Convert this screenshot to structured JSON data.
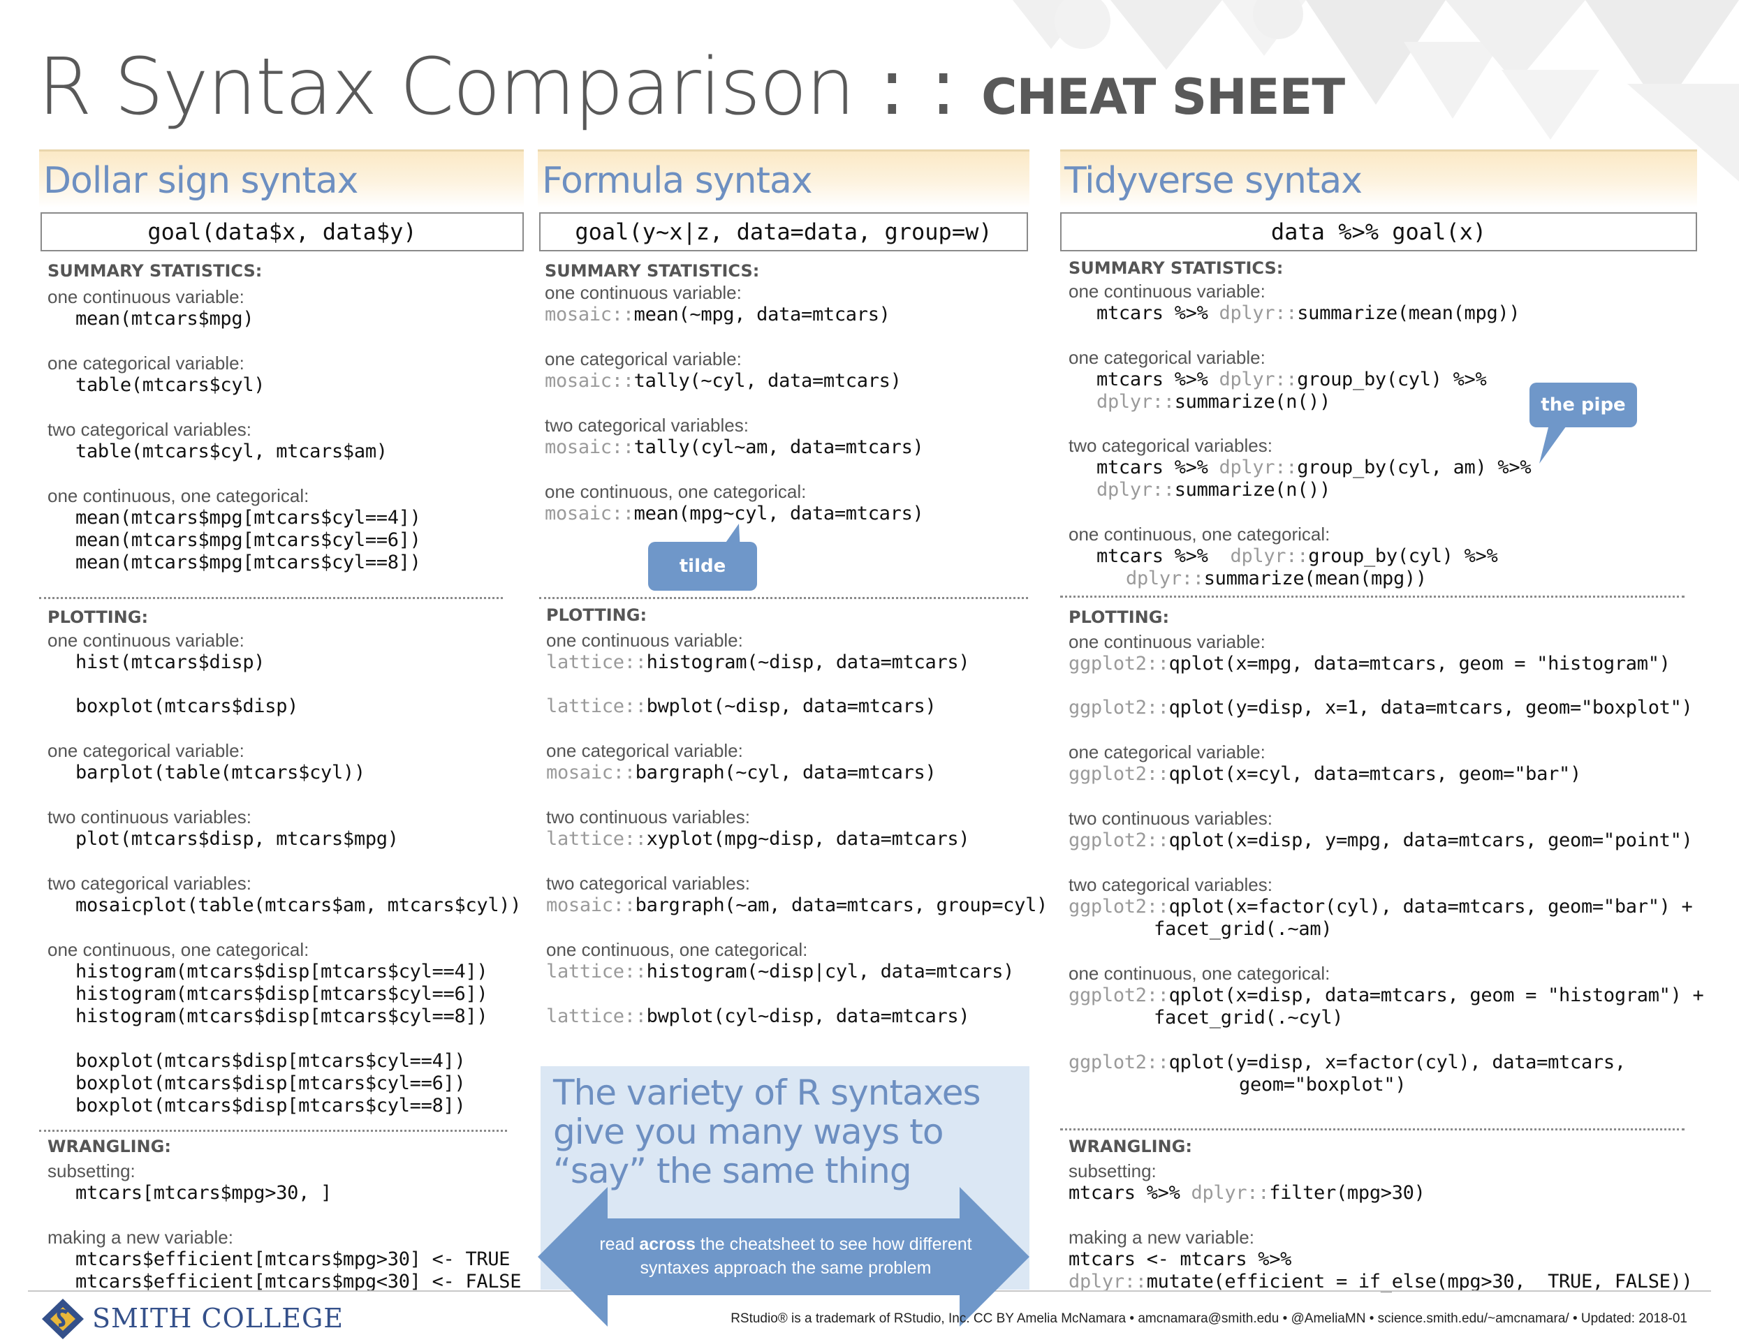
{
  "title": {
    "main": "R Syntax Comparison",
    "separator": " : : ",
    "sub": "CHEAT SHEET"
  },
  "columns": [
    {
      "heading": "Dollar sign syntax",
      "syntax": "goal(data$x, data$y)"
    },
    {
      "heading": "Formula syntax",
      "syntax": "goal(y~x|z, data=data, group=w)"
    },
    {
      "heading": "Tidyverse syntax",
      "syntax": "data %>% goal(x)"
    }
  ],
  "sections": {
    "summary": "SUMMARY STATISTICS:",
    "plotting": "PLOTTING:",
    "wrangling": "WRANGLING:"
  },
  "labels": {
    "one_cont": "one continuous variable:",
    "one_cat": "one categorical variable:",
    "two_cat": "two categorical variables:",
    "cont_cat": "one continuous, one categorical:",
    "two_cont": "two continuous variables:",
    "subsetting": "subsetting:",
    "new_var": "making a new variable:"
  },
  "dollar": {
    "mean_mpg": "mean(mtcars$mpg)",
    "table_cyl": "table(mtcars$cyl)",
    "table_cyl_am": "table(mtcars$cyl, mtcars$am)",
    "mean_4": "mean(mtcars$mpg[mtcars$cyl==4])",
    "mean_6": "mean(mtcars$mpg[mtcars$cyl==6])",
    "mean_8": "mean(mtcars$mpg[mtcars$cyl==8])",
    "hist": "hist(mtcars$disp)",
    "boxplot": "boxplot(mtcars$disp)",
    "barplot": "barplot(table(mtcars$cyl))",
    "plot": "plot(mtcars$disp, mtcars$mpg)",
    "mosaic": "mosaicplot(table(mtcars$am, mtcars$cyl))",
    "hist_4": "histogram(mtcars$disp[mtcars$cyl==4])",
    "hist_6": "histogram(mtcars$disp[mtcars$cyl==6])",
    "hist_8": "histogram(mtcars$disp[mtcars$cyl==8])",
    "box_4": "boxplot(mtcars$disp[mtcars$cyl==4])",
    "box_6": "boxplot(mtcars$disp[mtcars$cyl==6])",
    "box_8": "boxplot(mtcars$disp[mtcars$cyl==8])",
    "subset": "mtcars[mtcars$mpg>30, ]",
    "new_true": "mtcars$efficient[mtcars$mpg>30] <- TRUE",
    "new_false": "mtcars$efficient[mtcars$mpg<30] <- FALSE"
  },
  "formula": {
    "mosaic_pkg": "mosaic::",
    "lattice_pkg": "lattice::",
    "mean_mpg": "mean(~mpg, data=mtcars)",
    "tally_cyl": "tally(~cyl, data=mtcars)",
    "tally_cyl_am": "tally(cyl~am, data=mtcars)",
    "mean_mpg_cyl": "mean(mpg~cyl, data=mtcars)",
    "histogram": "histogram(~disp, data=mtcars)",
    "bwplot": "bwplot(~disp, data=mtcars)",
    "bargraph": "bargraph(~cyl, data=mtcars)",
    "xyplot": "xyplot(mpg~disp, data=mtcars)",
    "bargraph_group": "bargraph(~am, data=mtcars, group=cyl)",
    "histogram_cyl": "histogram(~disp|cyl, data=mtcars)",
    "bwplot_cyl": "bwplot(cyl~disp, data=mtcars)"
  },
  "tidy": {
    "dplyr_pkg": "dplyr::",
    "ggplot_pkg": "ggplot2::",
    "mtcars_pipe": "mtcars %>% ",
    "pipe": " %>%",
    "summarize_mean": "summarize(mean(mpg))",
    "group_cyl": "group_by(cyl)",
    "group_cyl_am": "group_by(cyl, am)",
    "summarize_n": "summarize(n())",
    "qplot_hist": "qplot(x=mpg, data=mtcars, geom = \"histogram\")",
    "qplot_box": "qplot(y=disp, x=1, data=mtcars, geom=\"boxplot\")",
    "qplot_bar": "qplot(x=cyl, data=mtcars, geom=\"bar\")",
    "qplot_point": "qplot(x=disp, y=mpg, data=mtcars, geom=\"point\")",
    "qplot_factor_bar": "qplot(x=factor(cyl), data=mtcars, geom=\"bar\") +",
    "facet_am": "facet_grid(.~am)",
    "qplot_hist_disp": "qplot(x=disp, data=mtcars, geom = \"histogram\") +",
    "facet_cyl": "facet_grid(.~cyl)",
    "qplot_box_factor": "qplot(y=disp, x=factor(cyl), data=mtcars,",
    "geom_boxplot": "geom=\"boxplot\")",
    "filter": "filter(mpg>30)",
    "filter_prefix": "mtcars %>% ",
    "mutate_prefix": "mtcars <- mtcars %>%",
    "mutate": "mutate(efficient = if_else(mpg>30,  TRUE, FALSE))"
  },
  "callouts": {
    "tilde": "tilde",
    "pipe": "the pipe"
  },
  "banner": {
    "headline": "The variety of R syntaxes give you many ways to “say” the same thing",
    "arrow_pre": "read ",
    "arrow_bold": "across",
    "arrow_post": " the cheatsheet to see how different syntaxes approach the same problem"
  },
  "footer": {
    "college": "SMITH COLLEGE",
    "credits": "RStudio® is a trademark of RStudio, Inc.    CC BY Amelia McNamara •  amcnamara@smith.edu  •  @AmeliaMN • science.smith.edu/~amcnamara/  •  Updated: 2018-01"
  },
  "colors": {
    "accent_blue": "#6d8fc1",
    "callout_blue": "#6f97c9",
    "header_gold": "#fbe9c6",
    "banner_bg": "#dbe7f4",
    "college_blue": "#34508a",
    "logo_gold": "#e9b73a"
  }
}
